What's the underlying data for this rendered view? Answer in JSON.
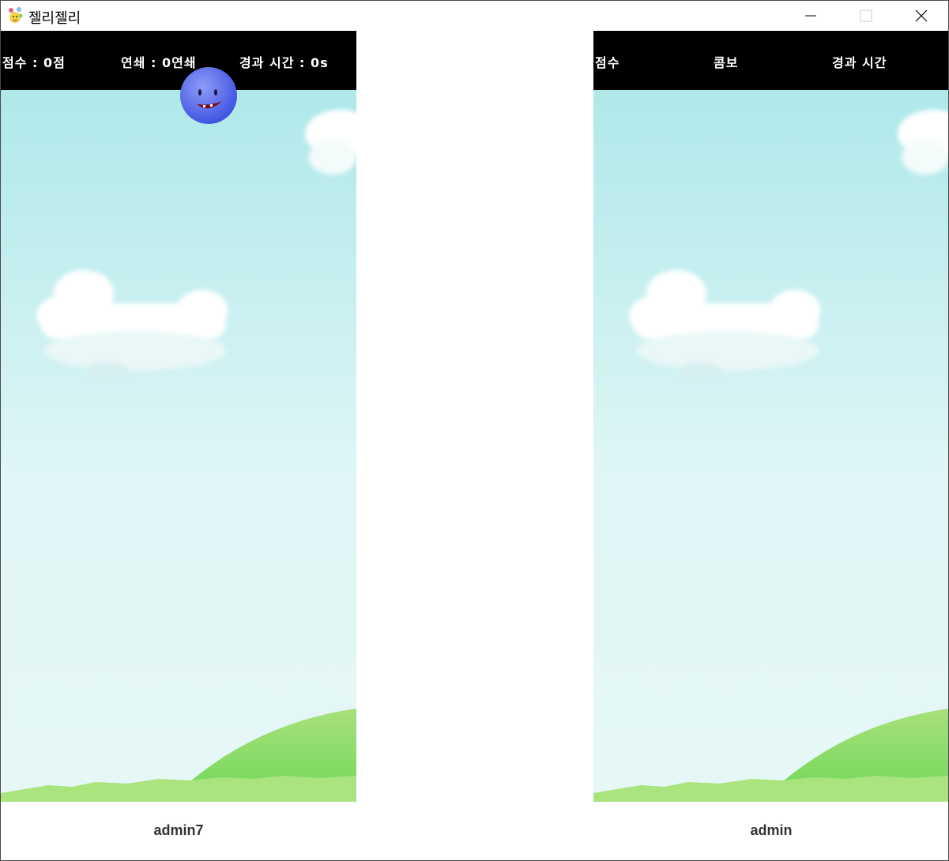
{
  "window": {
    "title": "젤리젤리",
    "icon": "jelly-app-icon",
    "controls": [
      "minimize-icon",
      "maximize-icon",
      "close-icon"
    ]
  },
  "players": {
    "left": {
      "hud": {
        "score": "점수 : 0점",
        "combo": "연쇄 : 0연쇄",
        "elapsed": "경과 시간 : 0s"
      },
      "name": "admin7"
    },
    "right": {
      "hud": {
        "score": "점수",
        "combo": "콤보",
        "elapsed": "경과 시간"
      },
      "name": "admin"
    }
  },
  "colors": {
    "hud_bg": "#000000",
    "sky_top": "#afe8ea",
    "sky_bottom": "#e6f7f7",
    "hill": "#7fd762",
    "jelly": "#5a6ee8"
  }
}
